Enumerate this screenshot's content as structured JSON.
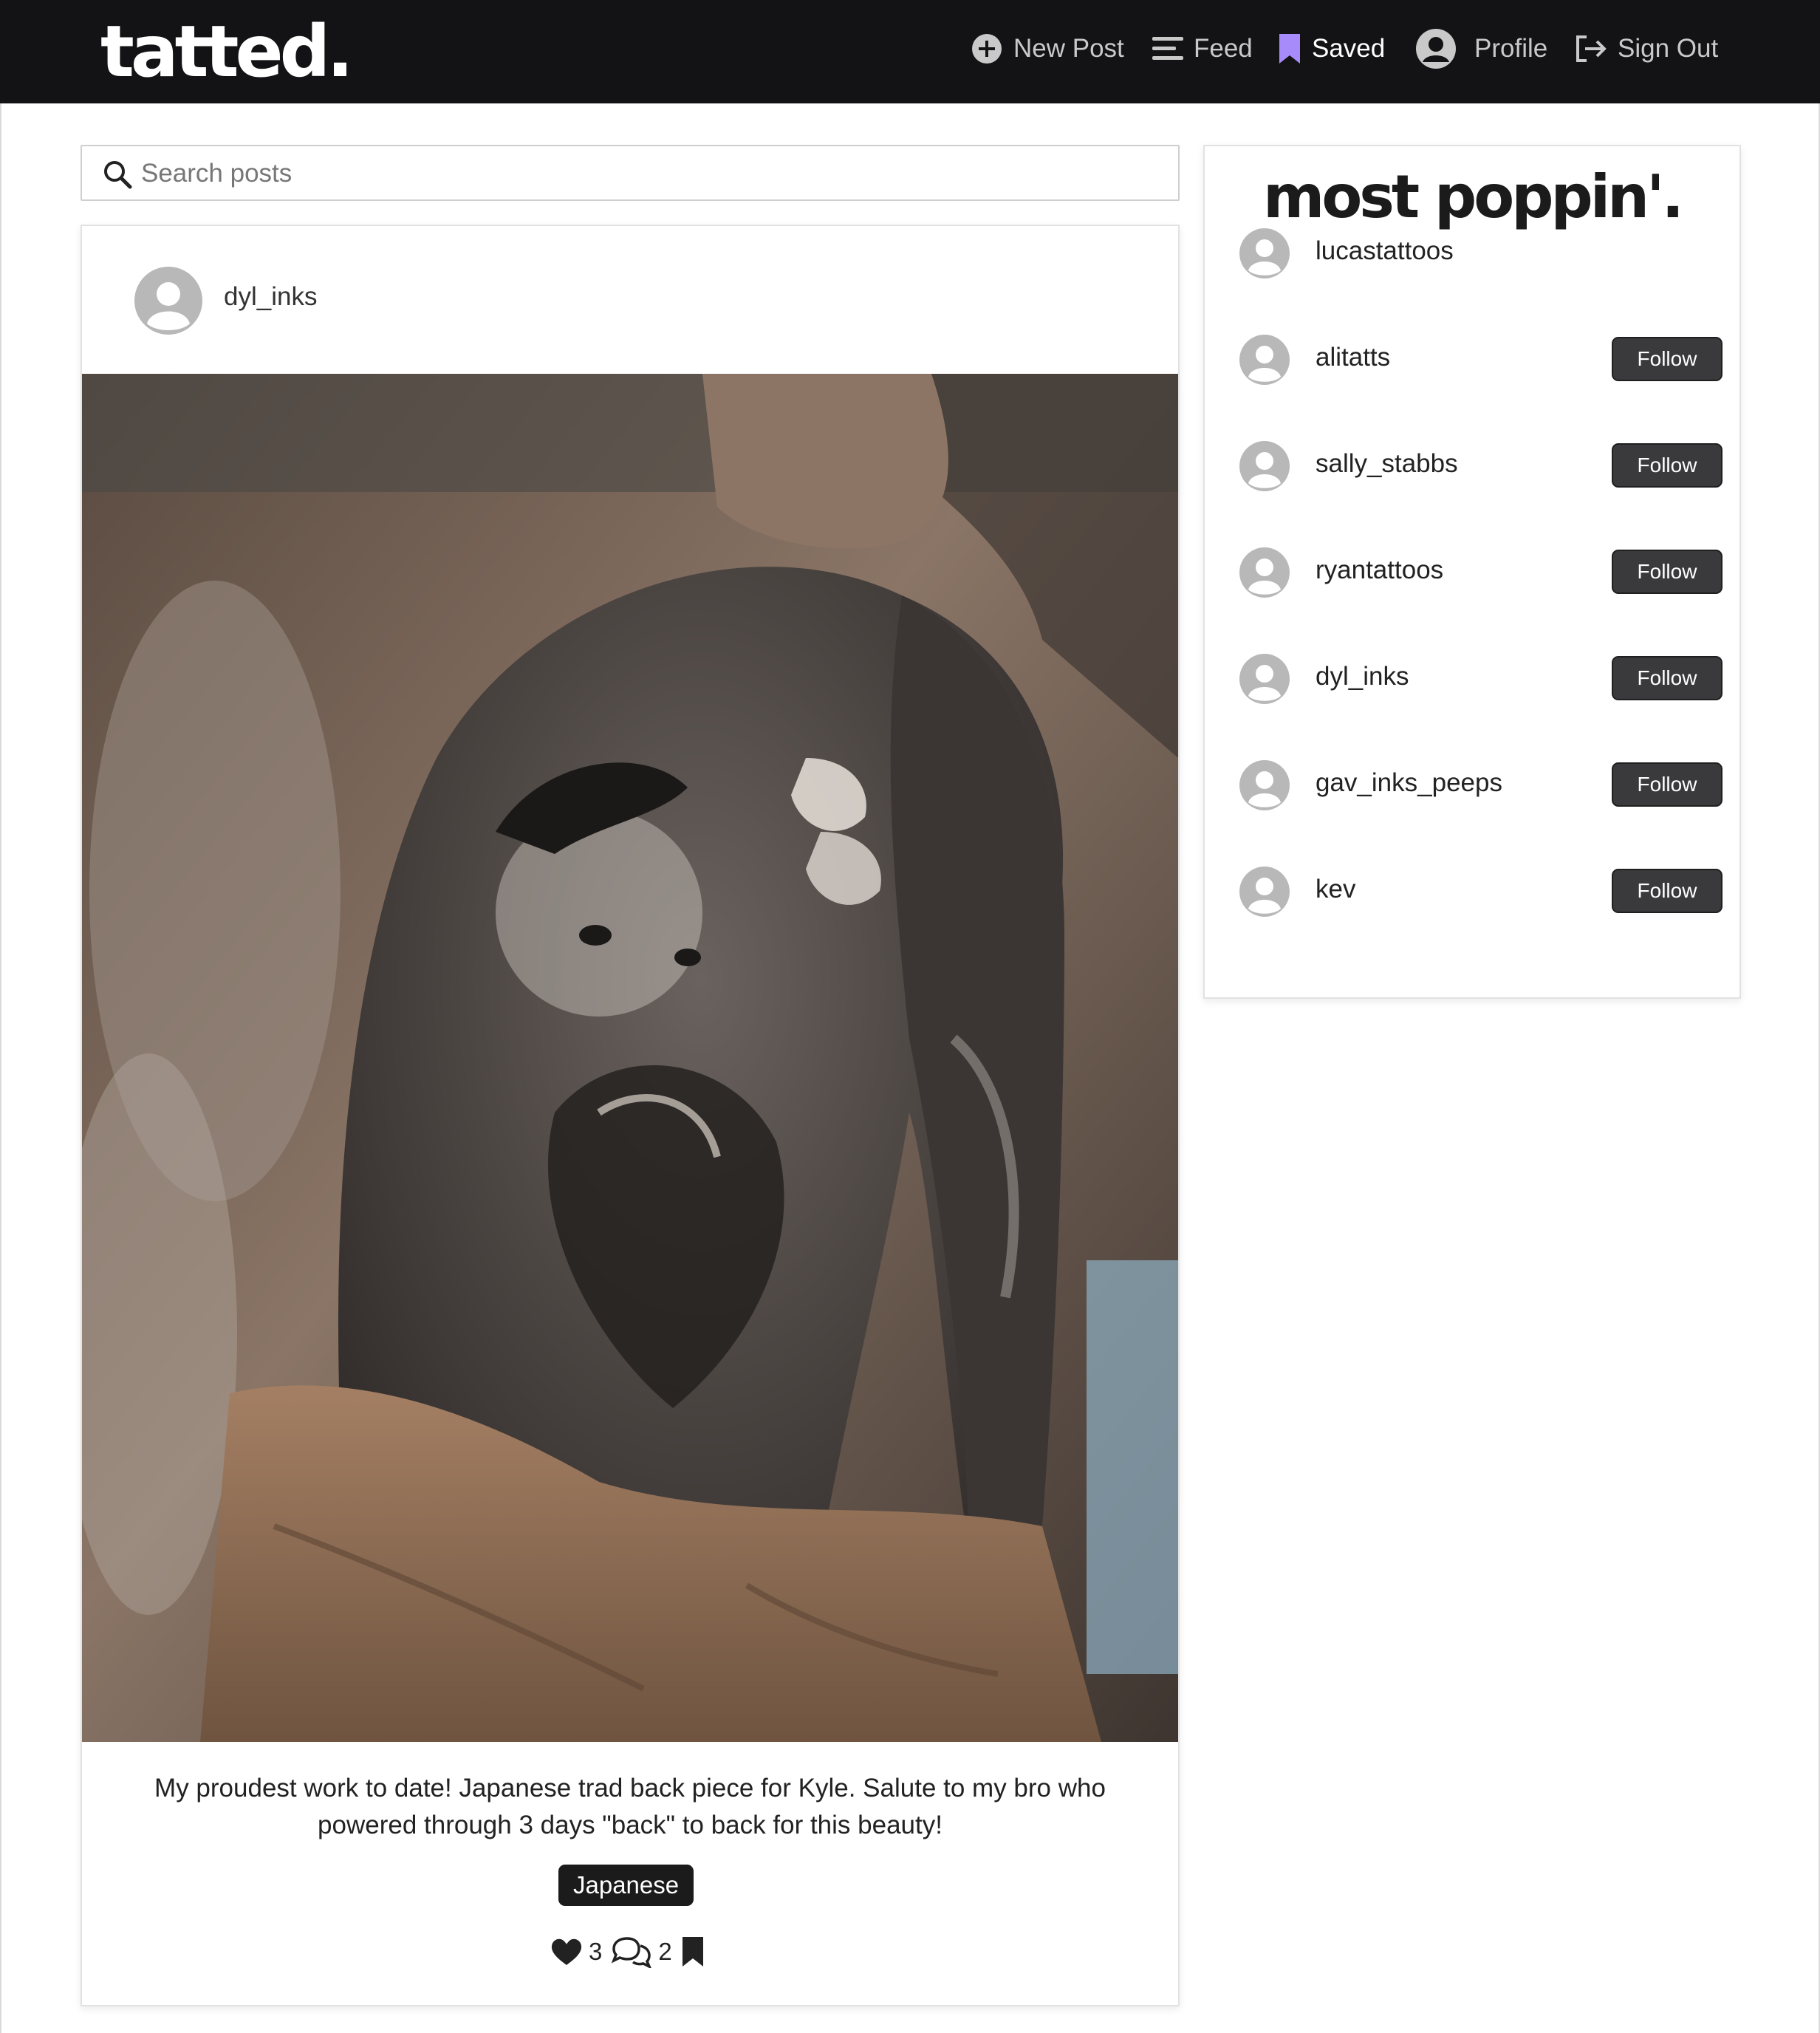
{
  "brand": "tatted.",
  "nav": [
    {
      "label": "New Post",
      "icon": "plus-circle-icon"
    },
    {
      "label": "Feed",
      "icon": "feed-lines-icon"
    },
    {
      "label": "Saved",
      "icon": "bookmark-icon",
      "active": true
    },
    {
      "label": "Profile",
      "icon": "user-avatar-icon"
    },
    {
      "label": "Sign Out",
      "icon": "sign-out-icon"
    }
  ],
  "search": {
    "placeholder": "Search posts",
    "value": ""
  },
  "post": {
    "username": "dyl_inks",
    "timestamp": "",
    "image_alt": "Japanese trad back piece tattoo",
    "caption": "My proudest work to date! Japanese trad back piece for Kyle. Salute to my bro who powered through 3 days \"back\" to back for this beauty!",
    "tag": "Japanese",
    "likes": "3",
    "comments": "2"
  },
  "sidebar": {
    "title": "most poppin'.",
    "follow_label": "Follow",
    "users": [
      {
        "name": "lucastattoos",
        "follow": false
      },
      {
        "name": "alitatts",
        "follow": true
      },
      {
        "name": "sally_stabbs",
        "follow": true
      },
      {
        "name": "ryantattoos",
        "follow": true
      },
      {
        "name": "dyl_inks",
        "follow": true
      },
      {
        "name": "gav_inks_peeps",
        "follow": true
      },
      {
        "name": "kev",
        "follow": true
      }
    ]
  },
  "colors": {
    "navbar": "#131315",
    "saved_icon": "#a78bfa",
    "button": "#3a3a3c",
    "tag": "#1b1b1b"
  }
}
